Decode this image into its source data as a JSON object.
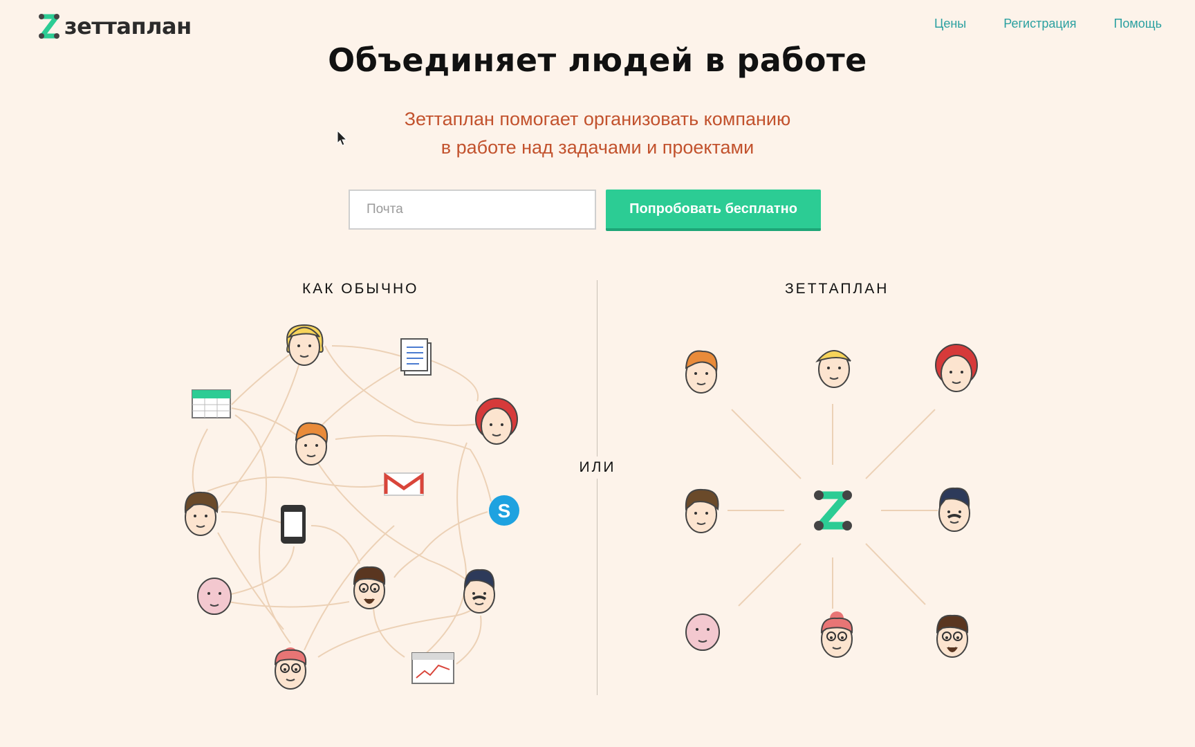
{
  "brand": {
    "name": "зеттаплан",
    "accent": "#2ccc94",
    "link_color": "#2aa0a0"
  },
  "nav": [
    {
      "label": "Цены"
    },
    {
      "label": "Регистрация"
    },
    {
      "label": "Помощь"
    }
  ],
  "hero": {
    "title": "Объединяет людей в работе",
    "subtitle_line1": "Зеттаплан помогает организовать компанию",
    "subtitle_line2": "в работе над задачами и проектами"
  },
  "signup": {
    "email_placeholder": "Почта",
    "email_value": "",
    "cta_label": "Попробовать бесплатно"
  },
  "comparison": {
    "left_title": "КАК ОБЫЧНО",
    "right_title": "ЗЕТТАПЛАН",
    "separator": "ИЛИ",
    "left_nodes": [
      "woman-blonde",
      "document-icon",
      "calendar-icon",
      "man-ginger",
      "woman-redhair",
      "gmail-icon",
      "man-brown",
      "phone-icon",
      "skype-icon",
      "old-man",
      "man-glasses-beard",
      "man-mustache",
      "woman-pink",
      "chart-icon"
    ],
    "right_nodes": [
      "man-ginger",
      "woman-blonde",
      "woman-redhair",
      "man-brown",
      "man-mustache",
      "old-man",
      "woman-pink",
      "man-glasses-beard"
    ]
  }
}
